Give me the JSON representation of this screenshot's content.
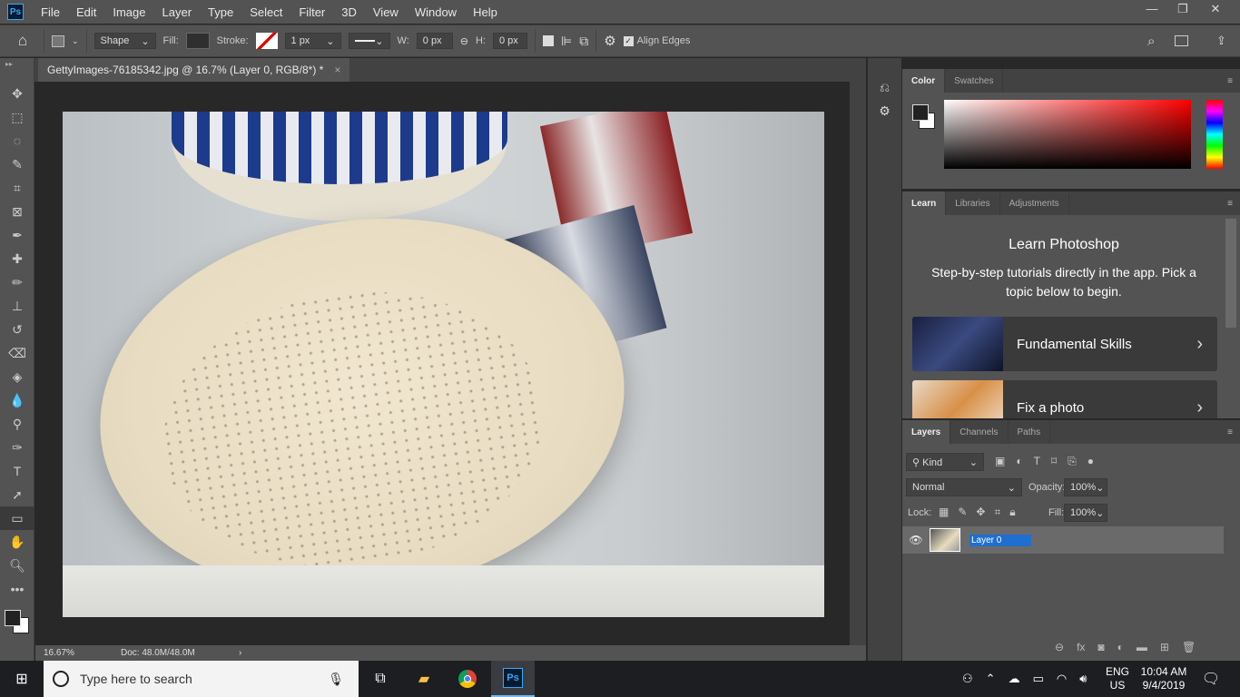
{
  "app": {
    "logo": "Ps",
    "menu": [
      "File",
      "Edit",
      "Image",
      "Layer",
      "Type",
      "Select",
      "Filter",
      "3D",
      "View",
      "Window",
      "Help"
    ],
    "window_controls": [
      "minimize",
      "restore",
      "close"
    ]
  },
  "options": {
    "mode": "Shape",
    "fill_label": "Fill:",
    "stroke_label": "Stroke:",
    "stroke_width": "1 px",
    "w_label": "W:",
    "w_value": "0 px",
    "h_label": "H:",
    "h_value": "0 px",
    "align_edges": "Align Edges",
    "align_edges_checked": true
  },
  "document": {
    "tab_title": "GettyImages-76185342.jpg @ 16.7% (Layer 0, RGB/8*) *",
    "close": "×"
  },
  "status": {
    "zoom": "16.67%",
    "doc": "Doc: 48.0M/48.0M",
    "arrow": "›"
  },
  "color_panel": {
    "tabs": [
      "Color",
      "Swatches"
    ],
    "accent": "#ff0000"
  },
  "learn_panel": {
    "tabs": [
      "Learn",
      "Libraries",
      "Adjustments"
    ],
    "title": "Learn Photoshop",
    "subtitle": "Step-by-step tutorials directly in the app. Pick a topic below to begin.",
    "cards": [
      {
        "label": "Fundamental Skills",
        "chevron": "›"
      },
      {
        "label": "Fix a photo",
        "chevron": "›"
      }
    ]
  },
  "layers_panel": {
    "tabs": [
      "Layers",
      "Channels",
      "Paths"
    ],
    "filter": "Kind",
    "blend_mode": "Normal",
    "opacity_label": "Opacity:",
    "opacity": "100%",
    "lock_label": "Lock:",
    "fill_label": "Fill:",
    "fill": "100%",
    "layers": [
      {
        "name": "Layer 0",
        "visible": true
      }
    ]
  },
  "taskbar": {
    "search_placeholder": "Type here to search",
    "lang": "ENG",
    "region": "US",
    "time": "10:04 AM",
    "date": "9/4/2019"
  }
}
